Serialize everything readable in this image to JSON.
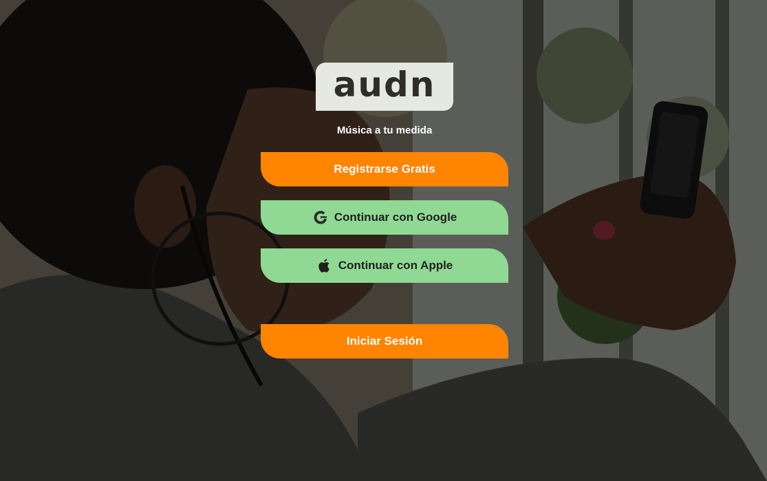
{
  "app": {
    "logo_text": "audn",
    "tagline": "Música a tu medida"
  },
  "buttons": {
    "register": {
      "label": "Registrarse Gratis"
    },
    "google": {
      "label": "Continuar con Google",
      "icon": "google-icon"
    },
    "apple": {
      "label": "Continuar con Apple",
      "icon": "apple-icon"
    },
    "login": {
      "label": "Iniciar Sesión"
    }
  },
  "colors": {
    "accent_orange": "#ff8400",
    "accent_green": "#90d994",
    "logo_bg": "#e6e9e2",
    "logo_text": "#2e2e26"
  }
}
